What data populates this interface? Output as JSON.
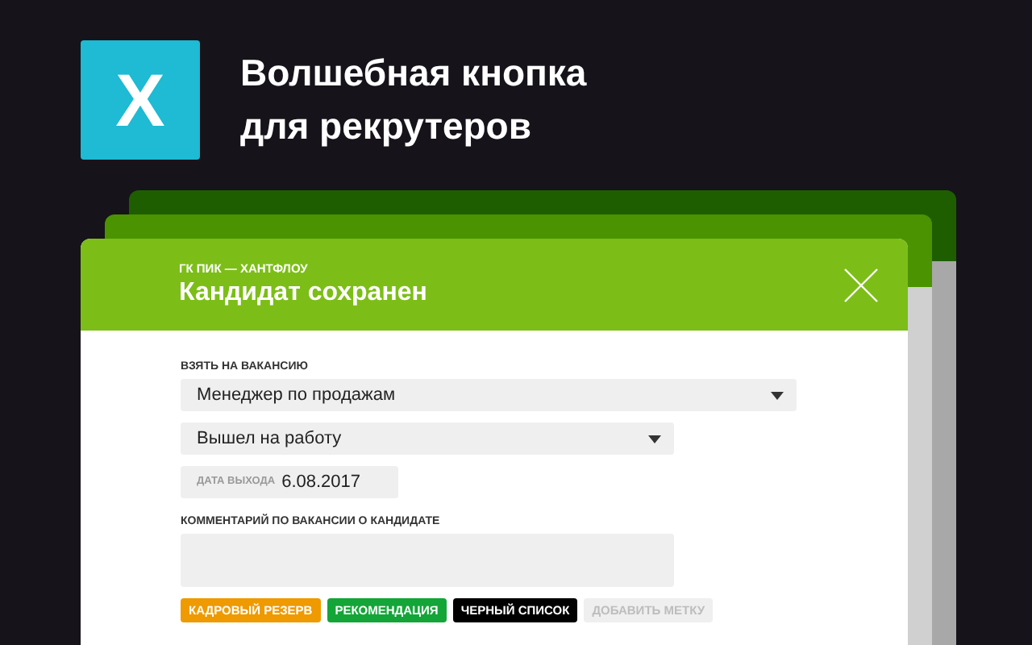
{
  "promo": {
    "logo_letter": "X",
    "headline": [
      "Волшебная кнопка",
      "для рекрутеров"
    ]
  },
  "dialog": {
    "subtitle": "ГК ПИК — ХАНТФЛОУ",
    "title": "Кандидат сохранен",
    "vacancy_label": "ВЗЯТЬ НА ВАКАНСИЮ",
    "vacancy_select": {
      "value": "Менеджер по продажам"
    },
    "status_select": {
      "value": "Вышел на работу"
    },
    "date_field": {
      "label": "ДАТА ВЫХОДА",
      "value": "6.08.2017"
    },
    "comment_label": "КОММЕНТАРИЙ ПО ВАКАНСИИ О КАНДИДАТЕ",
    "tags": [
      {
        "kind": "tag",
        "label": "КАДРОВЫЙ РЕЗЕРВ",
        "color": "#ee9a00"
      },
      {
        "kind": "tag",
        "label": "РЕКОМЕНДАЦИЯ",
        "color": "#13a538"
      },
      {
        "kind": "tag",
        "label": "ЧЕРНЫЙ СПИСОК",
        "color": "#000000"
      },
      {
        "kind": "add",
        "label": "ДОБАВИТЬ МЕТКУ"
      }
    ]
  }
}
